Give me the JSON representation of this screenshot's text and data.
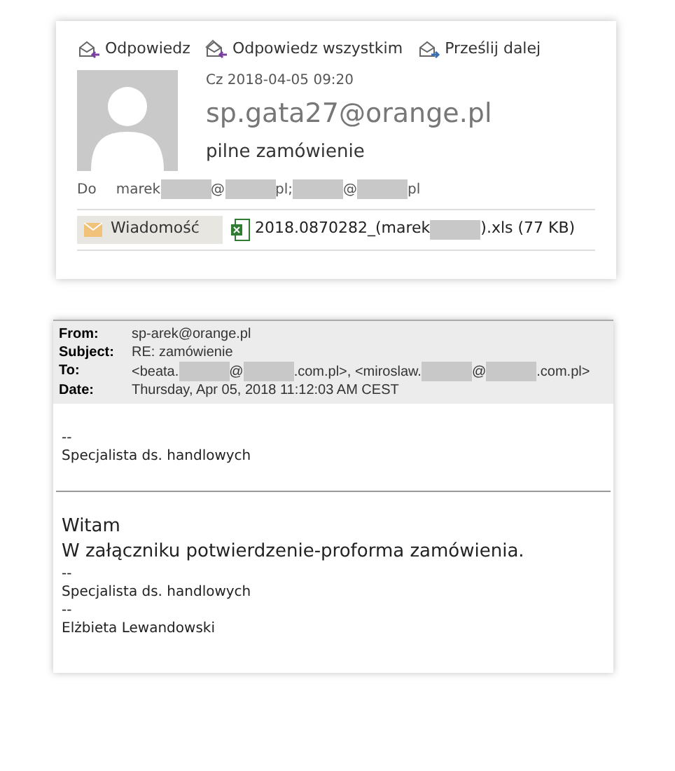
{
  "message": {
    "actions": [
      {
        "label": "Odpowiedz",
        "kind": "reply"
      },
      {
        "label": "Odpowiedz wszystkim",
        "kind": "reply_all"
      },
      {
        "label": "Prześlij dalej",
        "kind": "forward"
      }
    ],
    "date": "Cz 2018-04-05 09:20",
    "sender": "sp.gata27@orange.pl",
    "subject": "pilne zamówienie",
    "to_label": "Do",
    "to_parts": [
      {
        "kind": "text",
        "text": "marek"
      },
      {
        "kind": "redacted"
      },
      {
        "kind": "text",
        "text": "@"
      },
      {
        "kind": "redacted"
      },
      {
        "kind": "text",
        "text": "pl;"
      },
      {
        "kind": "redacted"
      },
      {
        "kind": "text",
        "text": "@"
      },
      {
        "kind": "redacted"
      },
      {
        "kind": "text",
        "text": "pl"
      }
    ],
    "message_tab": {
      "label": "Wiadomość",
      "selected": true
    },
    "attachment_parts": [
      {
        "kind": "text",
        "text": "2018.0870282_(marek"
      },
      {
        "kind": "redacted"
      },
      {
        "kind": "text",
        "text": ").xls (77 KB)"
      }
    ]
  },
  "quoted": {
    "headers": [
      {
        "label": "From:",
        "parts": [
          {
            "kind": "text",
            "text": "sp-arek@orange.pl"
          }
        ]
      },
      {
        "label": "Subject:",
        "parts": [
          {
            "kind": "text",
            "text": "RE: zamówienie"
          }
        ]
      },
      {
        "label": "To:",
        "parts": [
          {
            "kind": "text",
            "text": "<beata."
          },
          {
            "kind": "redacted"
          },
          {
            "kind": "text",
            "text": "@"
          },
          {
            "kind": "redacted"
          },
          {
            "kind": "text",
            "text": ".com.pl>, <miroslaw."
          },
          {
            "kind": "redacted"
          },
          {
            "kind": "text",
            "text": "@"
          },
          {
            "kind": "redacted"
          },
          {
            "kind": "text",
            "text": ".com.pl>"
          }
        ]
      },
      {
        "label": "Date:",
        "parts": [
          {
            "kind": "text",
            "text": "Thursday, Apr 05, 2018 11:12:03 AM CEST"
          }
        ]
      }
    ],
    "quoted_lines": [
      "--",
      "Specjalista ds. handlowych"
    ],
    "body_lines": [
      {
        "kind": "large",
        "text": "Witam"
      },
      {
        "kind": "large",
        "text": "W załączniku potwierdzenie-proforma zamówienia."
      },
      {
        "kind": "small",
        "text": "--"
      },
      {
        "kind": "small",
        "text": "Specjalista ds. handlowych"
      },
      {
        "kind": "small",
        "text": "--"
      },
      {
        "kind": "small",
        "text": "Elżbieta Lewandowski"
      }
    ]
  }
}
